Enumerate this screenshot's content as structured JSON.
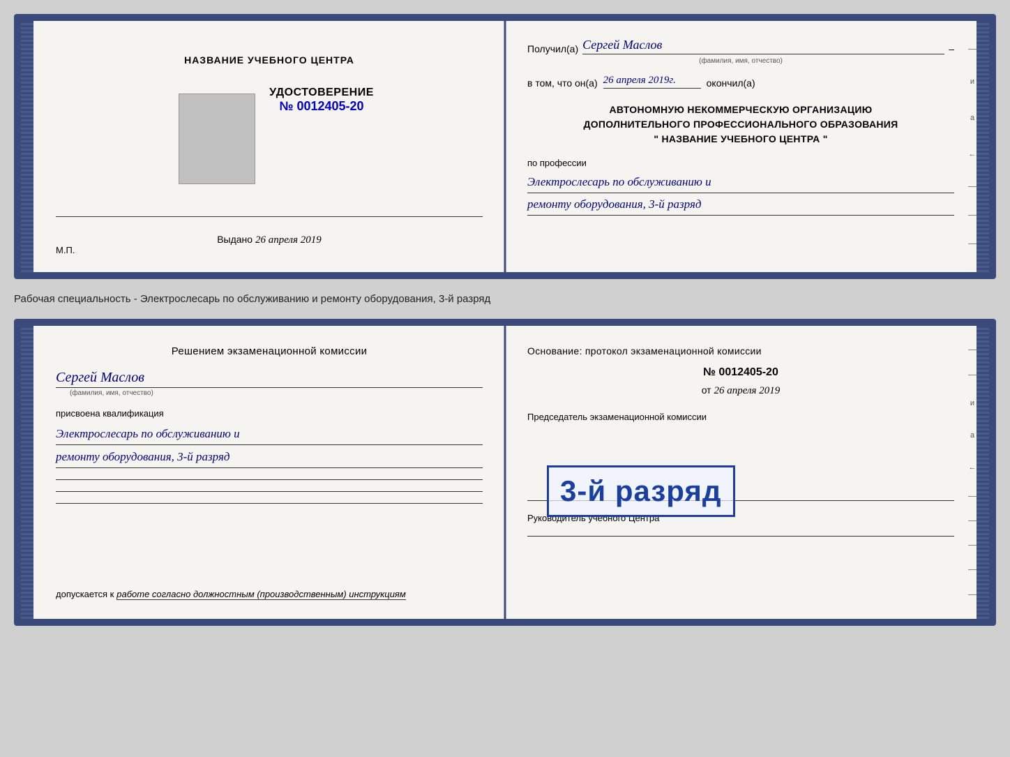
{
  "top_cert": {
    "left": {
      "center_title": "НАЗВАНИЕ УЧЕБНОГО ЦЕНТРА",
      "udost_label": "УДОСТОВЕРЕНИЕ",
      "udost_number": "№ 0012405-20",
      "vydano_label": "Выдано",
      "vydano_date": "26 апреля 2019",
      "mp_text": "М.П."
    },
    "right": {
      "poluchil_label": "Получил(а)",
      "poluchil_name": "Сергей Маслов",
      "fio_hint": "(фамилия, имя, отчество)",
      "vtom_label": "в том, что он(а)",
      "vtom_date": "26 апреля 2019г.",
      "vtom_okoncil": "окончил(а)",
      "org_line1": "АВТОНОМНУЮ НЕКОММЕРЧЕСКУЮ ОРГАНИЗАЦИЮ",
      "org_line2": "ДОПОЛНИТЕЛЬНОГО ПРОФЕССИОНАЛЬНОГО ОБРАЗОВАНИЯ",
      "org_line3": "\"    НАЗВАНИЕ УЧЕБНОГО ЦЕНТРА    \"",
      "po_professii": "по профессии",
      "profession_line1": "Электрослесарь по обслуживанию и",
      "profession_line2": "ремонту оборудования, 3-й разряд"
    }
  },
  "between_text": "Рабочая специальность - Электрослесарь по обслуживанию и ремонту оборудования, 3-й разряд",
  "bottom_cert": {
    "left": {
      "resheniem_title": "Решением экзаменационной комиссии",
      "name": "Сергей Маслов",
      "fio_hint": "(фамилия, имя, отчество)",
      "prisvoena": "присвоена квалификация",
      "kval_line1": "Электрослесарь по обслуживанию и",
      "kval_line2": "ремонту оборудования, 3-й разряд",
      "dopusk_label": "допускается к",
      "dopusk_text": "работе согласно должностным (производственным) инструкциям"
    },
    "right": {
      "osnovanie": "Основание: протокол экзаменационной комиссии",
      "protocol_number": "№  0012405-20",
      "ot_label": "от",
      "ot_date": "26 апреля 2019",
      "predsedatel_label": "Председатель экзаменационной комиссии",
      "stamp_text": "3-й разряд",
      "rukovoditel_label": "Руководитель учебного Центра"
    }
  },
  "right_edge": {
    "letters": [
      "и",
      "а",
      "←",
      "–",
      "–",
      "–",
      "–"
    ]
  },
  "colors": {
    "border": "#3a4a7a",
    "handwritten": "#000080",
    "stamp": "#1a3fa0",
    "background": "#f5f4f0"
  }
}
